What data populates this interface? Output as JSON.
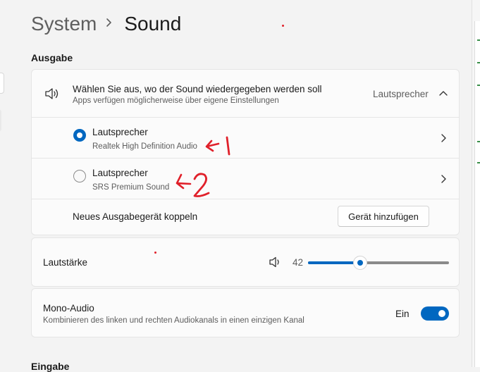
{
  "breadcrumb": {
    "parent": "System",
    "current": "Sound"
  },
  "output": {
    "heading": "Ausgabe",
    "selector": {
      "title": "Wählen Sie aus, wo der Sound wiedergegeben werden soll",
      "subtitle": "Apps verfügen möglicherweise über eigene Einstellungen",
      "selected_value": "Lautsprecher",
      "expanded": true
    },
    "devices": [
      {
        "name": "Lautsprecher",
        "detail": "Realtek High Definition Audio",
        "selected": true,
        "annotation": "←1"
      },
      {
        "name": "Lautsprecher",
        "detail": "SRS Premium Sound",
        "selected": false,
        "annotation": "←2"
      }
    ],
    "pair": {
      "label": "Neues Ausgabegerät koppeln",
      "button": "Gerät hinzufügen"
    }
  },
  "volume": {
    "label": "Lautstärke",
    "value": "42",
    "level": 42
  },
  "mono": {
    "title": "Mono-Audio",
    "subtitle": "Kombinieren des linken und rechten Audiokanals in einen einzigen Kanal",
    "state_label": "Ein",
    "on": true
  },
  "input": {
    "heading": "Eingabe"
  },
  "colors": {
    "accent": "#0067c0",
    "annotation": "#e0202a"
  },
  "icons": [
    "chevron-right-icon",
    "speaker-icon",
    "chevron-up-icon",
    "radio-selected-icon",
    "radio-unselected-icon",
    "volume-icon",
    "toggle-icon"
  ]
}
